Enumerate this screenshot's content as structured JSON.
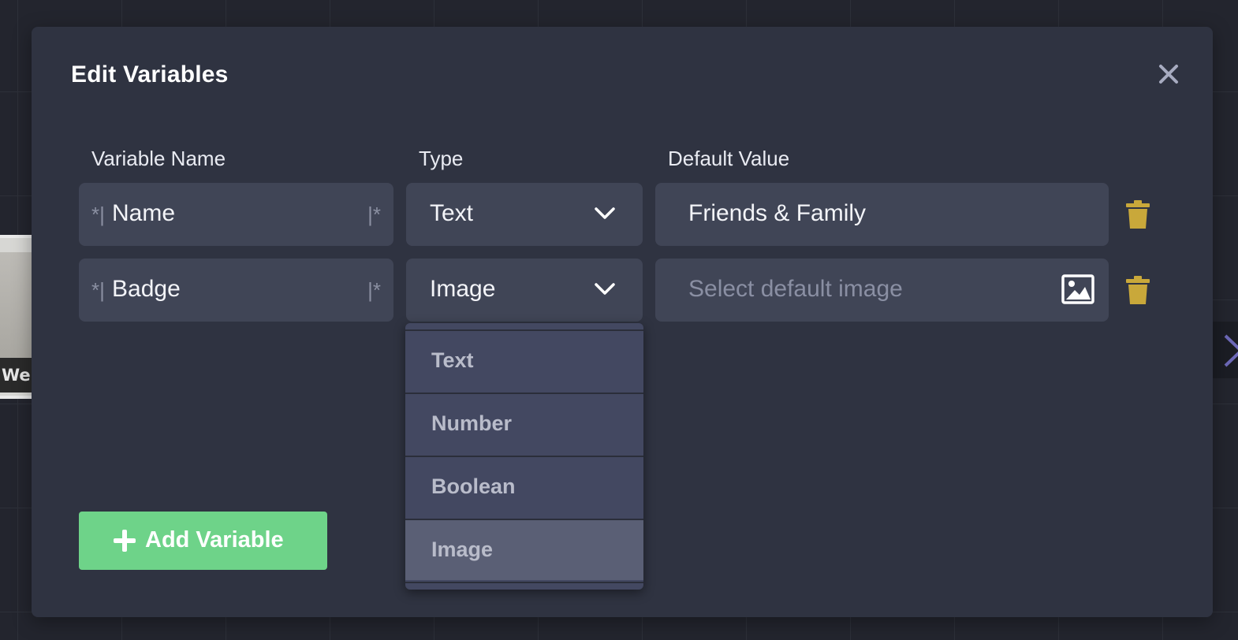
{
  "background": {
    "node_label": "We"
  },
  "modal": {
    "title": "Edit Variables",
    "columns": {
      "name": "Variable Name",
      "type": "Type",
      "default": "Default Value"
    },
    "rows": [
      {
        "name": "Name",
        "type": "Text",
        "default_value": "Friends & Family",
        "default_placeholder": ""
      },
      {
        "name": "Badge",
        "type": "Image",
        "default_value": "",
        "default_placeholder": "Select default image"
      }
    ],
    "name_markers": {
      "left": "*|",
      "right": "|*"
    },
    "type_dropdown": {
      "options": [
        "Text",
        "Number",
        "Boolean",
        "Image"
      ],
      "selected": "Image"
    },
    "add_button_label": "Add Variable"
  },
  "colors": {
    "modal_bg": "#2f3341",
    "field_bg": "#404556",
    "accent_green": "#6ed389",
    "trash_gold": "#c9a83a",
    "dropdown_bg": "#434861",
    "dropdown_selected": "#5a5f75"
  },
  "icons": {
    "close": "close-icon",
    "chevron": "chevron-down-icon",
    "trash": "trash-icon",
    "image": "image-icon",
    "plus": "plus-icon"
  }
}
